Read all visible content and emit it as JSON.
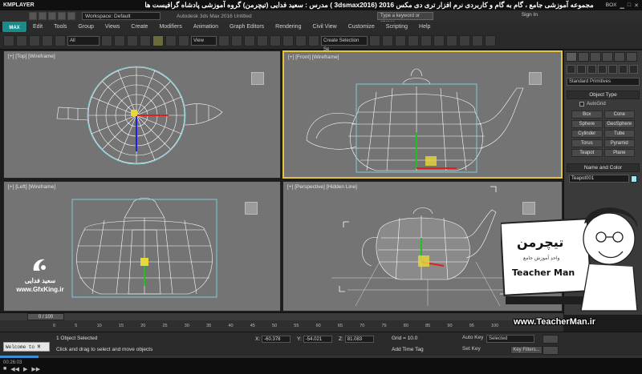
{
  "player": {
    "logo": "KMPLAYER",
    "banner": "مجموعه آموزشی جامع ، گام به گام و کاربردی نرم افزار تری دی مکس 2016 (3dsmax2016 )  مدرس : سعید فدایی (تیچرمن) گروه آموزشی پادشاه گرافیست ها",
    "right_label": "BOX",
    "progress_fraction": 0.06,
    "time": "00:26:03"
  },
  "titlebar": {
    "workspace": "Workspace: Default",
    "app_title": "Autodesk 3ds Max 2016    Untitled",
    "search_placeholder": "Type a keyword or phrase",
    "sign_in": "Sign In",
    "logo": "MAX"
  },
  "menu": [
    "Edit",
    "Tools",
    "Group",
    "Views",
    "Create",
    "Modifiers",
    "Animation",
    "Graph Editors",
    "Rendering",
    "Civil View",
    "Customize",
    "Scripting",
    "Help"
  ],
  "toolbar": {
    "filter": "All",
    "ref_coord": "View",
    "selection_set": "Create Selection Se"
  },
  "viewports": {
    "top": "[+] [Top] [Wireframe]",
    "front": "[+] [Front] [Wireframe]",
    "left": "[+] [Left] [Wireframe]",
    "perspective": "[+] [Perspective] [Hidden Line]"
  },
  "command_panel": {
    "category": "Standard Primitives",
    "object_type_title": "Object Type",
    "autogrid": "AutoGrid",
    "objects": [
      "Box",
      "Cone",
      "Sphere",
      "GeoSphere",
      "Cylinder",
      "Tube",
      "Torus",
      "Pyramid",
      "Teapot",
      "Plane"
    ],
    "name_color_title": "Name and Color",
    "object_name": "Teapot001",
    "object_color": "#9ee7f5"
  },
  "timeline": {
    "frame_counter": "0 / 100",
    "ticks": [
      "0",
      "5",
      "10",
      "15",
      "20",
      "25",
      "30",
      "35",
      "40",
      "45",
      "50",
      "55",
      "60",
      "65",
      "70",
      "75",
      "80",
      "85",
      "90",
      "95",
      "100"
    ]
  },
  "status": {
    "maxscript": "Welcome to M",
    "selected": "1 Object Selected",
    "prompt": "Click and drag to select and move objects",
    "x_label": "X:",
    "x": "-60.378",
    "y_label": "Y:",
    "y": "-54.021",
    "z_label": "Z:",
    "z": "81.083",
    "grid": "Grid = 10.0",
    "add_time_tag": "Add Time Tag",
    "auto_key": "Auto Key",
    "set_key": "Set Key",
    "selected_dd": "Selected",
    "key_filters": "Key Filters..."
  },
  "watermarks": {
    "left_name": "سعید فدایی",
    "left_site": "www.GfxKing.ir",
    "teacher_fa": "تیچرمن",
    "teacher_sub": "واحدِ آموزش جامع",
    "teacher_en": "Teacher Man",
    "teacher_site": "www.TeacherMan.ir"
  },
  "colors": {
    "viewport_bg": "#747474",
    "active_border": "#e4c53a",
    "wire": "#ffffff",
    "selection": "#7fe3f0"
  }
}
